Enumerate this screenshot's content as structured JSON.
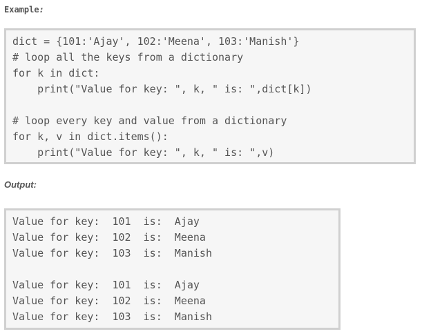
{
  "example": {
    "heading": "Example",
    "heading_suffix": ":",
    "code_lines": [
      "dict = {101:'Ajay', 102:'Meena', 103:'Manish'}",
      "# loop all the keys from a dictionary",
      "for k in dict:",
      "    print(\"Value for key: \", k, \" is: \",dict[k])",
      "",
      "# loop every key and value from a dictionary",
      "for k, v in dict.items():",
      "    print(\"Value for key: \", k, \" is: \",v)"
    ]
  },
  "output": {
    "heading": "Output:",
    "lines": [
      "Value for key:  101  is:  Ajay",
      "Value for key:  102  is:  Meena",
      "Value for key:  103  is:  Manish",
      "",
      "Value for key:  101  is:  Ajay",
      "Value for key:  102  is:  Meena",
      "Value for key:  103  is:  Manish"
    ]
  }
}
